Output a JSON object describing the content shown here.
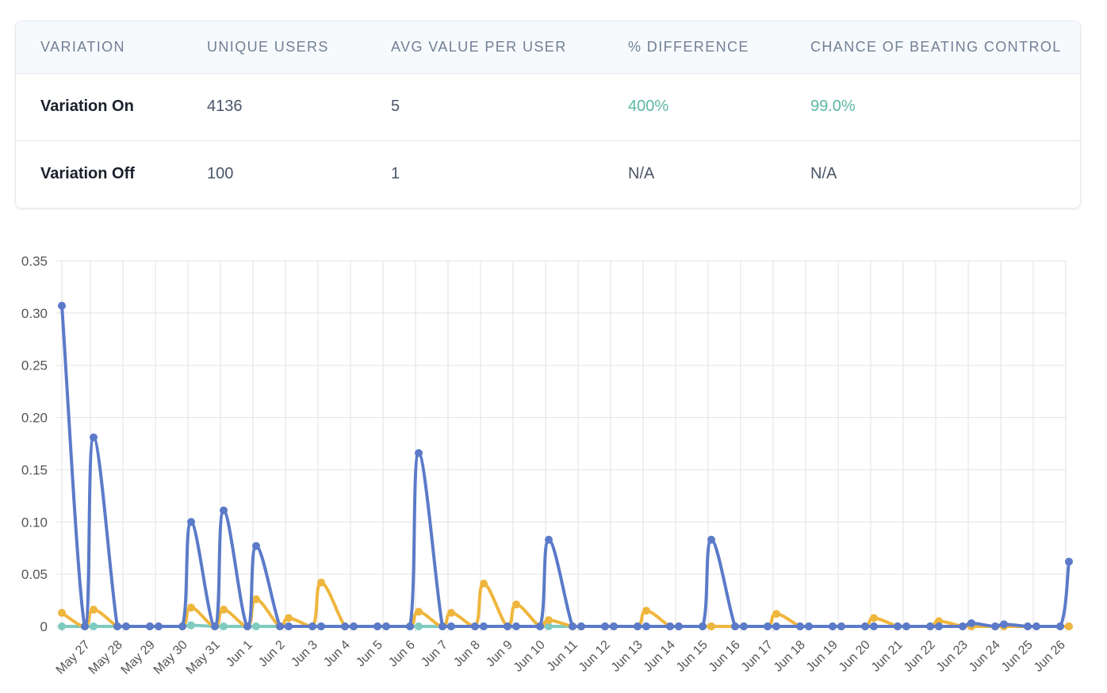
{
  "results_table": {
    "headers": [
      "VARIATION",
      "UNIQUE USERS",
      "AVG VALUE PER USER",
      "% DIFFERENCE",
      "CHANCE OF BEATING CONTROL"
    ],
    "rows": [
      {
        "variation": "Variation On",
        "unique_users": "4136",
        "avg_value": "5",
        "difference": "400%",
        "chance": "99.0%"
      },
      {
        "variation": "Variation Off",
        "unique_users": "100",
        "avg_value": "1",
        "difference": "N/A",
        "chance": "N/A"
      }
    ],
    "positive_color": "#5bb8a2"
  },
  "chart_data": {
    "type": "line",
    "title": "",
    "xlabel": "",
    "ylabel": "",
    "ylim": [
      0,
      0.35
    ],
    "y_ticks": [
      "0",
      "0.05",
      "0.10",
      "0.15",
      "0.20",
      "0.25",
      "0.30",
      "0.35"
    ],
    "x_tick_labels": [
      "May 27",
      "May 28",
      "May 29",
      "May 30",
      "May 31",
      "Jun 1",
      "Jun 2",
      "Jun 3",
      "Jun 4",
      "Jun 5",
      "Jun 6",
      "Jun 7",
      "Jun 8",
      "Jun 9",
      "Jun 10",
      "Jun 11",
      "Jun 12",
      "Jun 13",
      "Jun 14",
      "Jun 15",
      "Jun 16",
      "Jun 17",
      "Jun 18",
      "Jun 19",
      "Jun 20",
      "Jun 21",
      "Jun 22",
      "Jun 23",
      "Jun 24",
      "Jun 25",
      "Jun 26"
    ],
    "grid": true,
    "series": [
      {
        "color": "#5b7ac9",
        "points": [
          [
            "May 26",
            0.307
          ],
          [
            "May 27",
            0
          ],
          [
            "May 27",
            0.181
          ],
          [
            "May 28",
            0
          ],
          [
            "May 28",
            0
          ],
          [
            "May 29",
            0
          ],
          [
            "May 29",
            0
          ],
          [
            "May 30",
            0
          ],
          [
            "May 30",
            0.1
          ],
          [
            "May 31",
            0
          ],
          [
            "May 31",
            0.111
          ],
          [
            "Jun 1",
            0
          ],
          [
            "Jun 1",
            0.077
          ],
          [
            "Jun 2",
            0
          ],
          [
            "Jun 2",
            0
          ],
          [
            "Jun 3",
            0
          ],
          [
            "Jun 3",
            0
          ],
          [
            "Jun 4",
            0
          ],
          [
            "Jun 4",
            0
          ],
          [
            "Jun 5",
            0
          ],
          [
            "Jun 5",
            0
          ],
          [
            "Jun 6",
            0
          ],
          [
            "Jun 6",
            0.166
          ],
          [
            "Jun 7",
            0
          ],
          [
            "Jun 7",
            0
          ],
          [
            "Jun 8",
            0
          ],
          [
            "Jun 8",
            0
          ],
          [
            "Jun 9",
            0
          ],
          [
            "Jun 9",
            0
          ],
          [
            "Jun 10",
            0
          ],
          [
            "Jun 10",
            0.083
          ],
          [
            "Jun 11",
            0
          ],
          [
            "Jun 11",
            0
          ],
          [
            "Jun 12",
            0
          ],
          [
            "Jun 12",
            0
          ],
          [
            "Jun 13",
            0
          ],
          [
            "Jun 13",
            0
          ],
          [
            "Jun 14",
            0
          ],
          [
            "Jun 14",
            0
          ],
          [
            "Jun 15",
            0
          ],
          [
            "Jun 15",
            0.083
          ],
          [
            "Jun 16",
            0
          ],
          [
            "Jun 16",
            0
          ],
          [
            "Jun 17",
            0
          ],
          [
            "Jun 17",
            0
          ],
          [
            "Jun 18",
            0
          ],
          [
            "Jun 18",
            0
          ],
          [
            "Jun 19",
            0
          ],
          [
            "Jun 19",
            0
          ],
          [
            "Jun 20",
            0
          ],
          [
            "Jun 20",
            0
          ],
          [
            "Jun 21",
            0
          ],
          [
            "Jun 21",
            0
          ],
          [
            "Jun 22",
            0
          ],
          [
            "Jun 22",
            0
          ],
          [
            "Jun 23",
            0
          ],
          [
            "Jun 23",
            0.003
          ],
          [
            "Jun 24",
            0
          ],
          [
            "Jun 24",
            0.002
          ],
          [
            "Jun 25",
            0
          ],
          [
            "Jun 25",
            0
          ],
          [
            "Jun 26",
            0
          ],
          [
            "Jun 26",
            0.062
          ]
        ]
      },
      {
        "color": "#efb63d",
        "points": [
          [
            "May 26",
            0.013
          ],
          [
            "May 27",
            0
          ],
          [
            "May 27",
            0.016
          ],
          [
            "May 28",
            0
          ],
          [
            "May 28",
            0
          ],
          [
            "May 29",
            0
          ],
          [
            "May 29",
            0
          ],
          [
            "May 30",
            0
          ],
          [
            "May 30",
            0.018
          ],
          [
            "May 31",
            0
          ],
          [
            "May 31",
            0.016
          ],
          [
            "Jun 1",
            0
          ],
          [
            "Jun 1",
            0.026
          ],
          [
            "Jun 2",
            0
          ],
          [
            "Jun 2",
            0.008
          ],
          [
            "Jun 3",
            0
          ],
          [
            "Jun 3",
            0.042
          ],
          [
            "Jun 4",
            0
          ],
          [
            "Jun 4",
            0
          ],
          [
            "Jun 5",
            0
          ],
          [
            "Jun 5",
            0
          ],
          [
            "Jun 6",
            0
          ],
          [
            "Jun 6",
            0.014
          ],
          [
            "Jun 7",
            0
          ],
          [
            "Jun 7",
            0.013
          ],
          [
            "Jun 8",
            0
          ],
          [
            "Jun 8",
            0.041
          ],
          [
            "Jun 9",
            0
          ],
          [
            "Jun 9",
            0.021
          ],
          [
            "Jun 10",
            0
          ],
          [
            "Jun 10",
            0.006
          ],
          [
            "Jun 11",
            0
          ],
          [
            "Jun 11",
            0
          ],
          [
            "Jun 12",
            0
          ],
          [
            "Jun 12",
            0
          ],
          [
            "Jun 13",
            0
          ],
          [
            "Jun 13",
            0.015
          ],
          [
            "Jun 14",
            0
          ],
          [
            "Jun 14",
            0
          ],
          [
            "Jun 15",
            0
          ],
          [
            "Jun 15",
            0
          ],
          [
            "Jun 16",
            0
          ],
          [
            "Jun 16",
            0
          ],
          [
            "Jun 17",
            0
          ],
          [
            "Jun 17",
            0.012
          ],
          [
            "Jun 18",
            0
          ],
          [
            "Jun 18",
            0
          ],
          [
            "Jun 19",
            0
          ],
          [
            "Jun 19",
            0
          ],
          [
            "Jun 20",
            0
          ],
          [
            "Jun 20",
            0.008
          ],
          [
            "Jun 21",
            0
          ],
          [
            "Jun 21",
            0
          ],
          [
            "Jun 22",
            0
          ],
          [
            "Jun 22",
            0.005
          ],
          [
            "Jun 23",
            0
          ],
          [
            "Jun 23",
            0
          ],
          [
            "Jun 24",
            0
          ],
          [
            "Jun 24",
            0
          ],
          [
            "Jun 25",
            0
          ],
          [
            "Jun 25",
            0
          ],
          [
            "Jun 26",
            0
          ],
          [
            "Jun 26",
            0
          ]
        ]
      },
      {
        "color": "#7fcbc0",
        "points": [
          [
            "May 26",
            0
          ],
          [
            "May 27",
            0
          ],
          [
            "May 27",
            0
          ],
          [
            "May 28",
            0
          ],
          [
            "May 28",
            0
          ],
          [
            "May 29",
            0
          ],
          [
            "May 29",
            0
          ],
          [
            "May 30",
            0
          ],
          [
            "May 30",
            0.001
          ],
          [
            "May 31",
            0
          ],
          [
            "May 31",
            0
          ],
          [
            "Jun 1",
            0
          ],
          [
            "Jun 1",
            0
          ],
          [
            "Jun 2",
            0
          ],
          [
            "Jun 2",
            0
          ],
          [
            "Jun 3",
            0
          ],
          [
            "Jun 3",
            0
          ],
          [
            "Jun 4",
            0
          ],
          [
            "Jun 4",
            0
          ],
          [
            "Jun 5",
            0
          ],
          [
            "Jun 5",
            0
          ],
          [
            "Jun 6",
            0
          ],
          [
            "Jun 6",
            0
          ],
          [
            "Jun 7",
            0
          ],
          [
            "Jun 7",
            0
          ],
          [
            "Jun 8",
            0
          ],
          [
            "Jun 8",
            0
          ],
          [
            "Jun 9",
            0
          ],
          [
            "Jun 9",
            0
          ],
          [
            "Jun 10",
            0
          ],
          [
            "Jun 10",
            0
          ],
          [
            "Jun 11",
            0
          ],
          [
            "Jun 11",
            0
          ],
          [
            "Jun 12",
            0
          ],
          [
            "Jun 12",
            0
          ],
          [
            "Jun 13",
            0
          ],
          [
            "Jun 13",
            0
          ],
          [
            "Jun 14",
            0
          ],
          [
            "Jun 14",
            0
          ],
          [
            "Jun 15",
            0
          ],
          [
            "Jun 15",
            0
          ],
          [
            "Jun 16",
            0
          ],
          [
            "Jun 16",
            0
          ],
          [
            "Jun 17",
            0
          ],
          [
            "Jun 17",
            0
          ],
          [
            "Jun 18",
            0
          ],
          [
            "Jun 18",
            0
          ],
          [
            "Jun 19",
            0
          ],
          [
            "Jun 19",
            0
          ],
          [
            "Jun 20",
            0
          ],
          [
            "Jun 20",
            0
          ],
          [
            "Jun 21",
            0
          ],
          [
            "Jun 21",
            0
          ],
          [
            "Jun 22",
            0
          ],
          [
            "Jun 22",
            0
          ],
          [
            "Jun 23",
            0
          ],
          [
            "Jun 23",
            0
          ],
          [
            "Jun 24",
            0
          ],
          [
            "Jun 24",
            0
          ],
          [
            "Jun 25",
            0
          ],
          [
            "Jun 25",
            0
          ],
          [
            "Jun 26",
            0
          ],
          [
            "Jun 26",
            0
          ]
        ]
      }
    ]
  }
}
